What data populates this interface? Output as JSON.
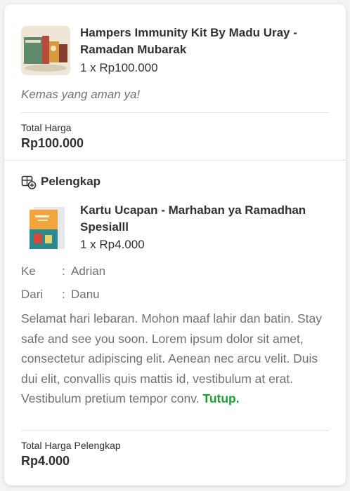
{
  "product": {
    "name": "Hampers Immunity Kit By Madu Uray - Ramadan Mubarak",
    "quantity_price": "1 x Rp100.000",
    "note": "Kemas yang aman ya!",
    "total_label": "Total Harga",
    "total_value": "Rp100.000"
  },
  "addon": {
    "heading": "Pelengkap",
    "icon": "gift-card-icon",
    "name": "Kartu Ucapan - Marhaban ya Ramadhan Spesialll",
    "quantity_price": "1 x Rp4.000",
    "to_label": "Ke",
    "to_value": "Adrian",
    "from_label": "Dari",
    "from_value": "Danu",
    "separator": ":",
    "message": "Selamat hari lebaran. Mohon maaf lahir dan batin. Stay safe and see you soon. Lorem ipsum dolor sit amet, consectetur adipiscing elit. Aenean nec arcu velit. Duis dui elit, convallis quis mattis id, vestibulum at erat. Vestibulum pretium tempor conv.",
    "collapse_label": "Tutup.",
    "total_label": "Total Harga Pelengkap",
    "total_value": "Rp4.000"
  },
  "colors": {
    "accent": "#19a32d",
    "text": "#2e3137",
    "muted": "#6d7178",
    "divider": "#e5e7e9"
  }
}
